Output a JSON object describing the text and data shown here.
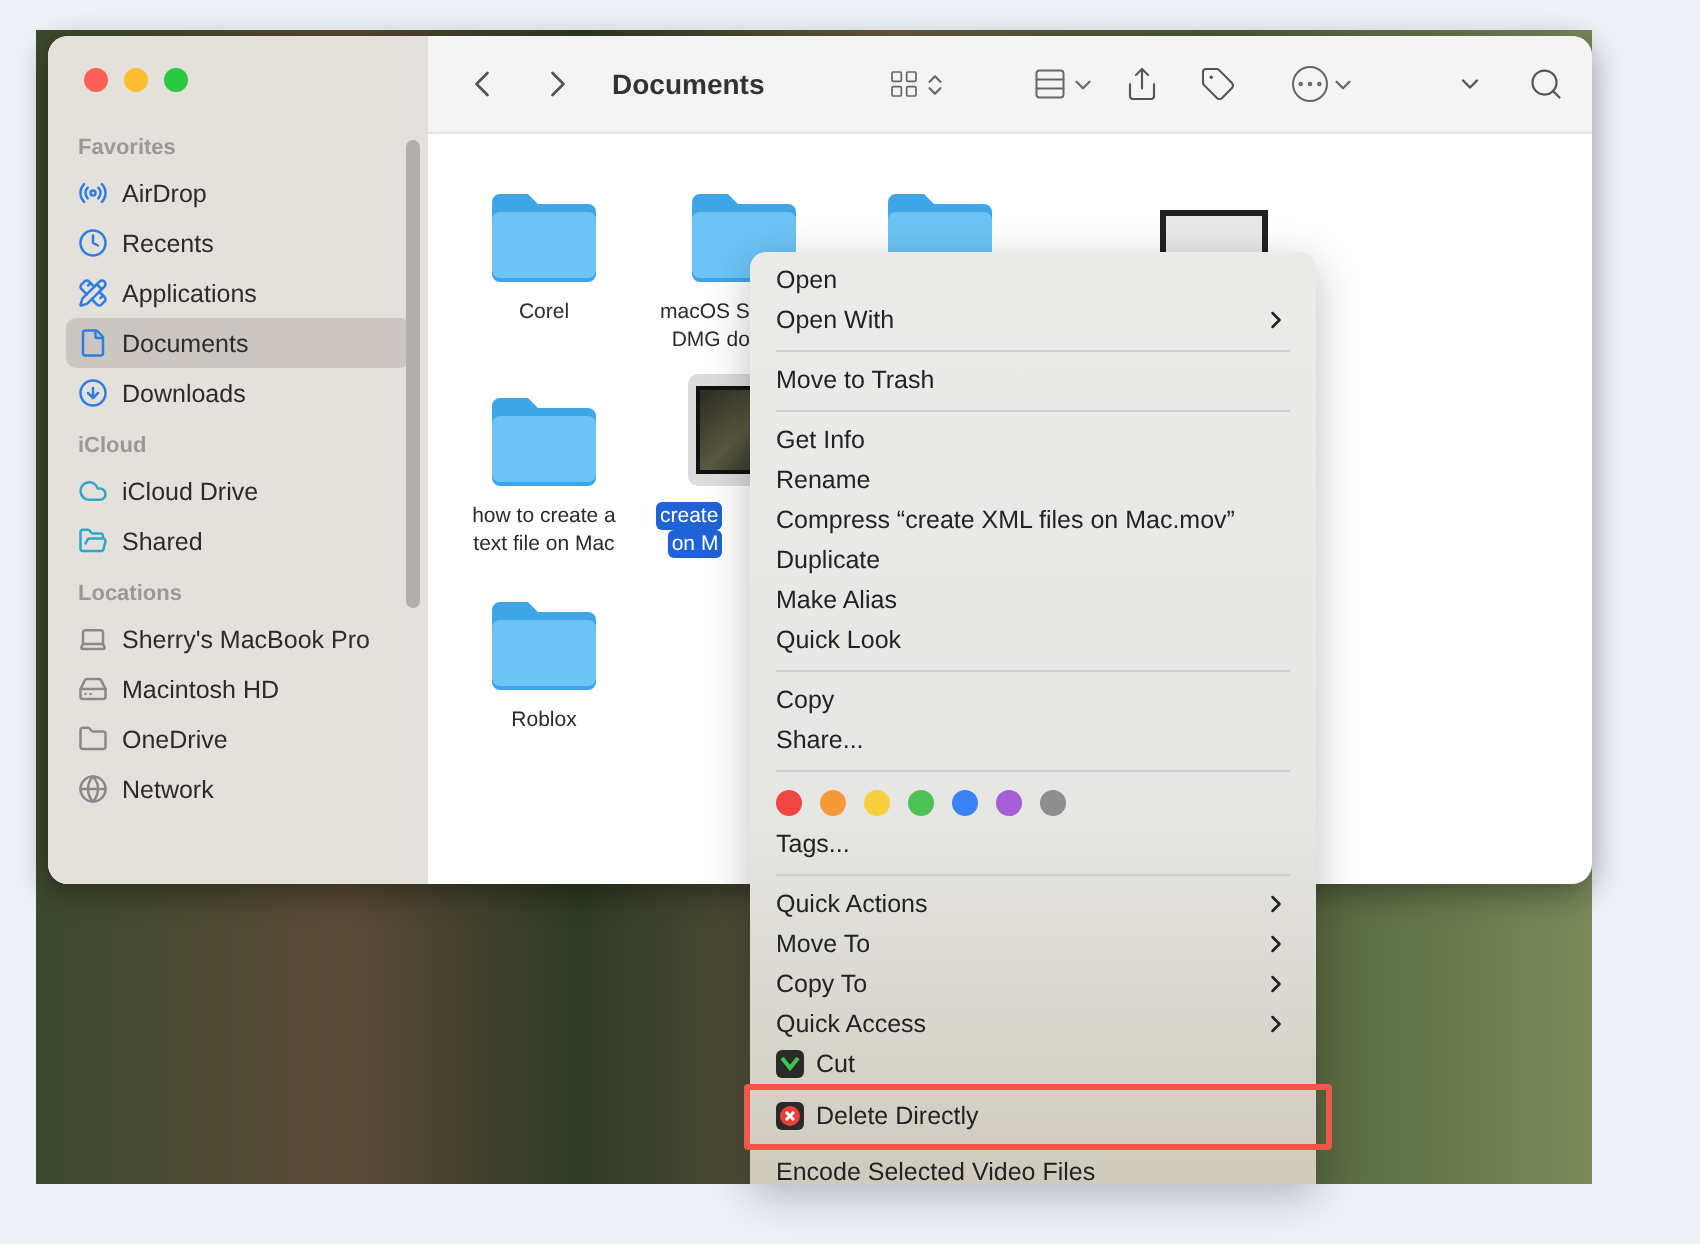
{
  "window": {
    "title": "Documents"
  },
  "sidebar": [
    {
      "heading": "Favorites",
      "items": [
        {
          "label": "AirDrop",
          "selected": false
        },
        {
          "label": "Recents",
          "selected": false
        },
        {
          "label": "Applications",
          "selected": false
        },
        {
          "label": "Documents",
          "selected": true
        },
        {
          "label": "Downloads",
          "selected": false
        }
      ]
    },
    {
      "heading": "iCloud",
      "items": [
        {
          "label": "iCloud Drive",
          "selected": false
        },
        {
          "label": "Shared",
          "selected": false
        }
      ]
    },
    {
      "heading": "Locations",
      "items": [
        {
          "label": "Sherry's MacBook Pro",
          "selected": false
        },
        {
          "label": "Macintosh HD",
          "selected": false
        },
        {
          "label": "OneDrive",
          "selected": false
        },
        {
          "label": "Network",
          "selected": false
        }
      ]
    }
  ],
  "files": [
    [
      {
        "kind": "folder",
        "lines": [
          "Corel"
        ],
        "selected": false
      },
      {
        "kind": "folder",
        "lines": [
          "macOS S",
          "DMG do"
        ],
        "selected": false
      },
      {
        "kind": "folder",
        "selected": false
      },
      {
        "kind": "image",
        "selected": false
      }
    ],
    [
      {
        "kind": "folder",
        "lines": [
          "how to create a",
          "text file on Mac"
        ],
        "selected": false
      },
      {
        "kind": "video",
        "lines": [
          "create",
          "on M"
        ],
        "selected": true
      }
    ],
    [
      {
        "kind": "folder",
        "lines": [
          "Roblox"
        ],
        "selected": false
      }
    ]
  ],
  "context_menu": [
    {
      "kind": "item",
      "label": "Open",
      "submenu": false
    },
    {
      "kind": "item",
      "label": "Open With",
      "submenu": true
    },
    {
      "kind": "separator"
    },
    {
      "kind": "item",
      "label": "Move to Trash",
      "submenu": false
    },
    {
      "kind": "separator"
    },
    {
      "kind": "item",
      "label": "Get Info",
      "submenu": false
    },
    {
      "kind": "item",
      "label": "Rename",
      "submenu": false
    },
    {
      "kind": "item",
      "label": "Compress “create XML files on Mac.mov”",
      "submenu": false
    },
    {
      "kind": "item",
      "label": "Duplicate",
      "submenu": false
    },
    {
      "kind": "item",
      "label": "Make Alias",
      "submenu": false
    },
    {
      "kind": "item",
      "label": "Quick Look",
      "submenu": false
    },
    {
      "kind": "separator"
    },
    {
      "kind": "item",
      "label": "Copy",
      "submenu": false
    },
    {
      "kind": "item",
      "label": "Share...",
      "submenu": false
    },
    {
      "kind": "separator"
    },
    {
      "kind": "tags",
      "tags": [
        {
          "color": "#f0463f"
        },
        {
          "color": "#f59a3b"
        },
        {
          "color": "#f7cf3f"
        },
        {
          "color": "#4cc255"
        },
        {
          "color": "#3b82f6"
        },
        {
          "color": "#a45ed6"
        },
        {
          "color": "#8e8e8e"
        }
      ]
    },
    {
      "kind": "item",
      "label": "Tags...",
      "submenu": false
    },
    {
      "kind": "separator"
    },
    {
      "kind": "item",
      "label": "Quick Actions",
      "submenu": true
    },
    {
      "kind": "item",
      "label": "Move To",
      "submenu": true
    },
    {
      "kind": "item",
      "label": "Copy To",
      "submenu": true
    },
    {
      "kind": "item",
      "label": "Quick Access",
      "submenu": true
    },
    {
      "kind": "app",
      "label": "Cut",
      "highlighted": false
    },
    {
      "kind": "app",
      "label": "Delete Directly",
      "highlighted": true
    },
    {
      "kind": "item",
      "label": "Encode Selected Video Files",
      "submenu": false
    }
  ]
}
